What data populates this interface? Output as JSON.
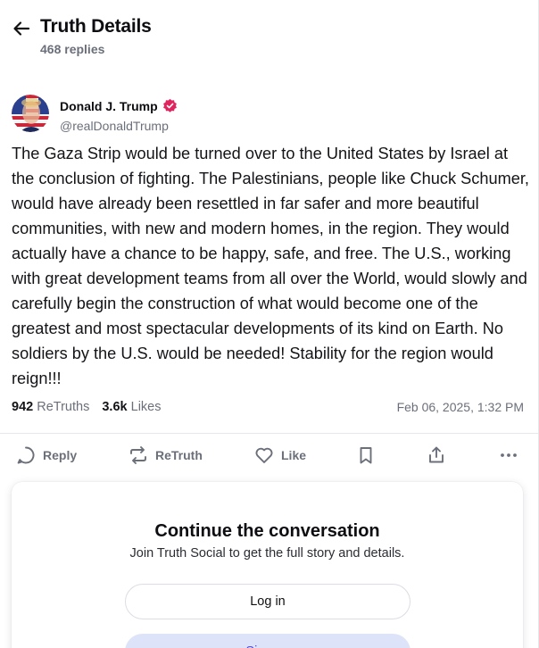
{
  "header": {
    "title": "Truth Details",
    "replies": "468 replies"
  },
  "post": {
    "author_name": "Donald J. Trump",
    "author_handle": "@realDonaldTrump",
    "verified_color": "#e0245e",
    "text": "The Gaza Strip would be turned over to the United States by Israel at the conclusion of fighting. The Palestinians, people like Chuck Schumer, would have already been resettled in far safer and more beautiful communities, with new and modern homes, in the region. They would actually have a chance to be happy, safe, and free. The U.S., working with great development teams from all over the World, would slowly and carefully begin the construction of what would become one of the greatest and most spectacular developments of its kind on Earth. No soldiers by the U.S. would be needed! Stability for the region would reign!!!",
    "retruths_count": "942",
    "retruths_label": "ReTruths",
    "likes_count": "3.6k",
    "likes_label": "Likes",
    "date": "Feb 06, 2025, 1:32 PM"
  },
  "actions": {
    "reply": "Reply",
    "retruth": "ReTruth",
    "like": "Like"
  },
  "cta": {
    "title": "Continue the conversation",
    "subtitle": "Join Truth Social to get the full story and details.",
    "login": "Log in",
    "signup": "Sign up"
  },
  "colors": {
    "accent": "#5448ee",
    "muted": "#6b6f7a",
    "signup_bg": "#dde3f8"
  }
}
